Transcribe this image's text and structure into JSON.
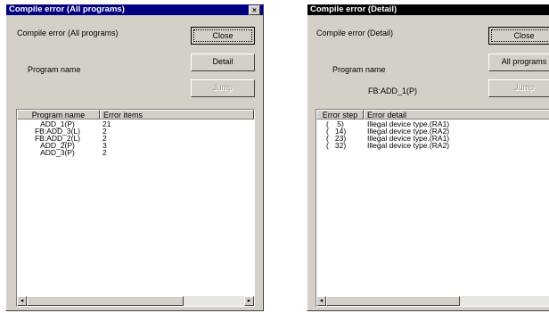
{
  "left_dialog": {
    "title": "Compile error (All programs)",
    "close_glyph": "×",
    "heading": "Compile error (All programs)",
    "program_name_label": "Program name",
    "buttons": {
      "close": "Close",
      "detail": "Detail",
      "jump": "Jump"
    },
    "columns": [
      "Program name",
      "Error items"
    ],
    "rows": [
      {
        "name": "ADD_1(P)",
        "count": "21"
      },
      {
        "name": "FB:ADD_3(L)",
        "count": "2"
      },
      {
        "name": "FB:ADD_2(L)",
        "count": "2"
      },
      {
        "name": "ADD_2(P)",
        "count": "3"
      },
      {
        "name": "ADD_3(P)",
        "count": "2"
      }
    ]
  },
  "right_dialog": {
    "title": "Compile error (Detail)",
    "heading": "Compile error (Detail)",
    "program_name_label": "Program name",
    "program_name_value": "FB:ADD_1(P)",
    "buttons": {
      "close": "Close",
      "all_programs": "All programs",
      "jump": "Jump"
    },
    "columns": [
      "Error step",
      "Error detail"
    ],
    "rows": [
      {
        "step": "(    5)",
        "detail": "Illegal device type.(RA1)"
      },
      {
        "step": "(   14)",
        "detail": "Illegal device type.(RA2)"
      },
      {
        "step": "(   23)",
        "detail": "Illegal device type.(RA1)"
      },
      {
        "step": "(   32)",
        "detail": "Illegal device type.(RA2)"
      }
    ]
  },
  "scrollbar": {
    "left_arrow": "◂",
    "right_arrow": "▸"
  },
  "colors": {
    "dialog_face": "#d4d0c8",
    "title_bar_active": "#000080"
  }
}
